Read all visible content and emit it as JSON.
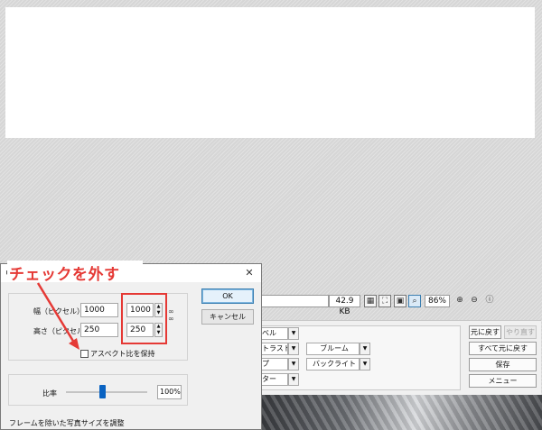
{
  "canvas": {
    "note": ""
  },
  "status_bar": {
    "file_size": "42.9 KB",
    "zoom": "86%",
    "icons": [
      "transparency-grid-icon",
      "fit-screen-icon",
      "actual-size-icon",
      "zoom-tool-icon",
      "zoom-in-icon",
      "zoom-out-icon",
      "info-icon"
    ]
  },
  "adjust_panel": {
    "dropdowns": [
      {
        "label": "ベル"
      },
      {
        "label": "トラスト"
      },
      {
        "label": "プ"
      },
      {
        "label": "ター"
      },
      {
        "label": "ブルーム"
      },
      {
        "label": "バックライト"
      }
    ],
    "buttons": {
      "undo": "元に戻す",
      "redo": "やり直す",
      "undo_all": "すべて元に戻す",
      "save": "保存",
      "menu": "メニュー"
    }
  },
  "dialog": {
    "title": "リ",
    "width_label": "幅（ピクセル）",
    "height_label": "高さ（ピクセル）",
    "width_original": "1000",
    "height_original": "250",
    "width_new": "1000",
    "height_new": "250",
    "aspect_label": "アスペクト比を保持",
    "aspect_checked": false,
    "ok_label": "OK",
    "cancel_label": "キャンセル",
    "ratio_label": "比率",
    "ratio_value": "100%",
    "ratio_slider_fraction": 0.45,
    "frame_note": "フレームを除いた写真サイズを調整"
  },
  "annotation": {
    "text": "チェックを外す",
    "color": "#e53935"
  }
}
